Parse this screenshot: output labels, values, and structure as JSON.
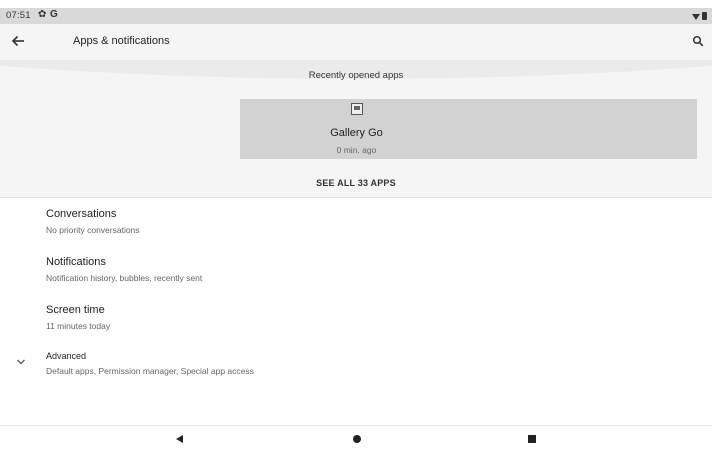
{
  "status_bar": {
    "time": "07:51",
    "gear_glyph": "✿",
    "g_glyph": "G",
    "icons": [
      "settings-icon",
      "google-icon",
      "wifi-icon",
      "battery-icon"
    ]
  },
  "app_bar": {
    "title": "Apps & notifications",
    "back_icon": "arrow-left-icon",
    "search_icon": "search-icon"
  },
  "recent": {
    "title": "Recently opened apps",
    "apps": [
      {
        "name": "Gallery Go",
        "time": "0 min. ago",
        "icon": "gallery-icon"
      }
    ],
    "see_all": "SEE ALL 33 APPS"
  },
  "list": {
    "items": [
      {
        "title": "Conversations",
        "subtitle": "No priority conversations"
      },
      {
        "title": "Notifications",
        "subtitle": "Notification history, bubbles, recently sent"
      },
      {
        "title": "Screen time",
        "subtitle": "11 minutes today"
      },
      {
        "title": "Advanced",
        "subtitle": "Default apps, Permission manager, Special app access",
        "icon": "chevron-down-icon"
      }
    ]
  },
  "nav": {
    "icons": [
      "nav-back-icon",
      "nav-home-icon",
      "nav-recents-icon"
    ]
  },
  "colors": {
    "background": "#ffffff",
    "header": "#f5f5f5",
    "status_bar": "#d9d9d9",
    "card": "#d2d2d2",
    "text": "#222222",
    "subtext": "#666666"
  }
}
